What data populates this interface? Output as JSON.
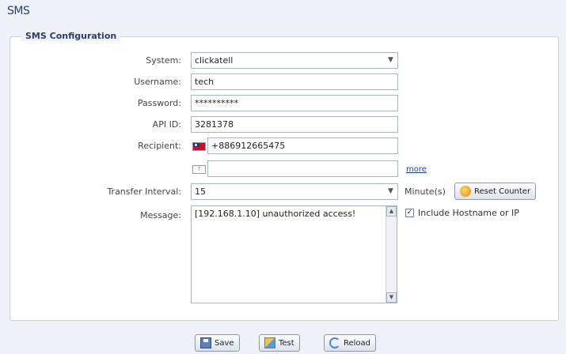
{
  "page": {
    "title": "SMS"
  },
  "config": {
    "legend": "SMS Configuration",
    "system": {
      "label": "System:",
      "value": "clickatell"
    },
    "username": {
      "label": "Username:",
      "value": "tech"
    },
    "password": {
      "label": "Password:",
      "value": "**********"
    },
    "api_id": {
      "label": "API ID:",
      "value": "3281378"
    },
    "recipient": {
      "label": "Recipient:",
      "value": "+886912665475",
      "value2": "",
      "more_link": "more"
    },
    "transfer_interval": {
      "label": "Transfer Interval:",
      "value": "15",
      "unit": "Minute(s)",
      "reset_label": "Reset Counter"
    },
    "message": {
      "label": "Message:",
      "value": "[192.168.1.10] unauthorized access!"
    },
    "include_hostname": {
      "label": "Include Hostname or IP",
      "checked": true
    }
  },
  "actions": {
    "save": "Save",
    "test": "Test",
    "reload": "Reload"
  },
  "icons": {
    "reset": "reset-counter-icon",
    "save": "save-icon",
    "test": "test-icon",
    "reload": "reload-icon",
    "flag": "taiwan-flag-icon"
  }
}
